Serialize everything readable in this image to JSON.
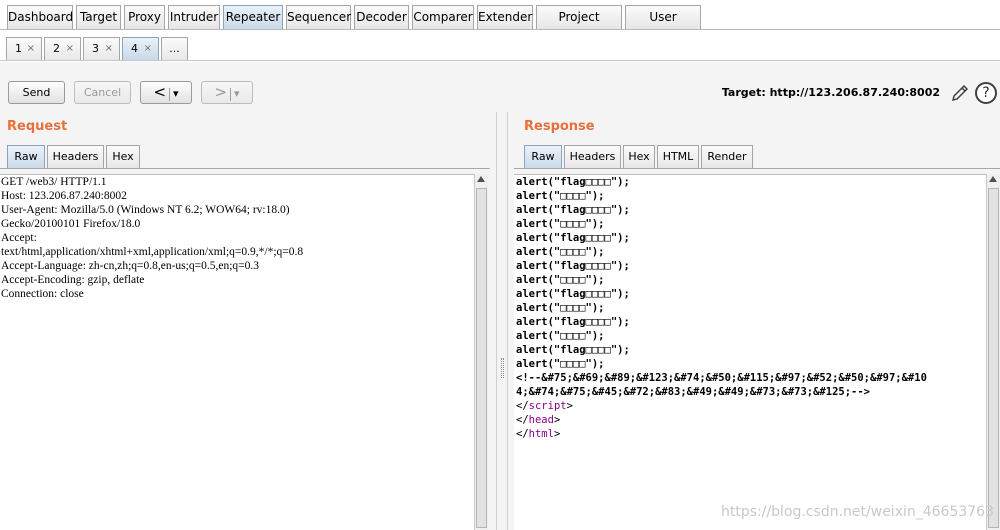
{
  "top_tabs": [
    {
      "label": "Dashboard",
      "active": false
    },
    {
      "label": "Target",
      "active": false
    },
    {
      "label": "Proxy",
      "active": false
    },
    {
      "label": "Intruder",
      "active": false
    },
    {
      "label": "Repeater",
      "active": true
    },
    {
      "label": "Sequencer",
      "active": false
    },
    {
      "label": "Decoder",
      "active": false
    },
    {
      "label": "Comparer",
      "active": false
    },
    {
      "label": "Extender",
      "active": false
    },
    {
      "label": "Project options",
      "active": false
    },
    {
      "label": "User options",
      "active": false
    }
  ],
  "sub_tabs": [
    {
      "label": "1",
      "close": "×",
      "active": false
    },
    {
      "label": "2",
      "close": "×",
      "active": false
    },
    {
      "label": "3",
      "close": "×",
      "active": false
    },
    {
      "label": "4",
      "close": "×",
      "active": true
    },
    {
      "label": "...",
      "close": "",
      "active": false
    }
  ],
  "toolbar": {
    "send_label": "Send",
    "cancel_label": "Cancel",
    "back_label": "<",
    "back_dropdown": "▾",
    "forward_label": ">",
    "forward_dropdown": "▾",
    "target_text": "Target: http://123.206.87.240:8002",
    "help_label": "?"
  },
  "request": {
    "title": "Request",
    "tabs": [
      {
        "label": "Raw",
        "active": true
      },
      {
        "label": "Headers",
        "active": false
      },
      {
        "label": "Hex",
        "active": false
      }
    ],
    "lines": [
      "GET /web3/ HTTP/1.1",
      "Host: 123.206.87.240:8002",
      "User-Agent: Mozilla/5.0 (Windows NT 6.2; WOW64; rv:18.0)",
      "Gecko/20100101 Firefox/18.0",
      "Accept:",
      "text/html,application/xhtml+xml,application/xml;q=0.9,*/*;q=0.8",
      "Accept-Language: zh-cn,zh;q=0.8,en-us;q=0.5,en;q=0.3",
      "Accept-Encoding: gzip, deflate",
      "Connection: close"
    ]
  },
  "response": {
    "title": "Response",
    "tabs": [
      {
        "label": "Raw",
        "active": true
      },
      {
        "label": "Headers",
        "active": false
      },
      {
        "label": "Hex",
        "active": false
      },
      {
        "label": "HTML",
        "active": false
      },
      {
        "label": "Render",
        "active": false
      }
    ],
    "lines": [
      "alert(\"flag□□□□\");",
      "alert(\"□□□□\");",
      "alert(\"flag□□□□\");",
      "alert(\"□□□□\");",
      "alert(\"flag□□□□\");",
      "alert(\"□□□□\");",
      "alert(\"flag□□□□\");",
      "alert(\"□□□□\");",
      "alert(\"flag□□□□\");",
      "alert(\"□□□□\");",
      "alert(\"flag□□□□\");",
      "alert(\"□□□□\");",
      "alert(\"flag□□□□\");",
      "alert(\"□□□□\");",
      "<!--&#75;&#69;&#89;&#123;&#74;&#50;&#115;&#97;&#52;&#50;&#97;&#10",
      "4;&#74;&#75;&#45;&#72;&#83;&#49;&#49;&#73;&#73;&#125;-->"
    ],
    "closing_tags": [
      {
        "open": "</",
        "name": "script",
        "close": ">"
      },
      {
        "open": "</",
        "name": "head",
        "close": ">"
      },
      {
        "open": "</",
        "name": "html",
        "close": ">"
      }
    ]
  },
  "watermark": "https://blog.csdn.net/weixin_46653763"
}
